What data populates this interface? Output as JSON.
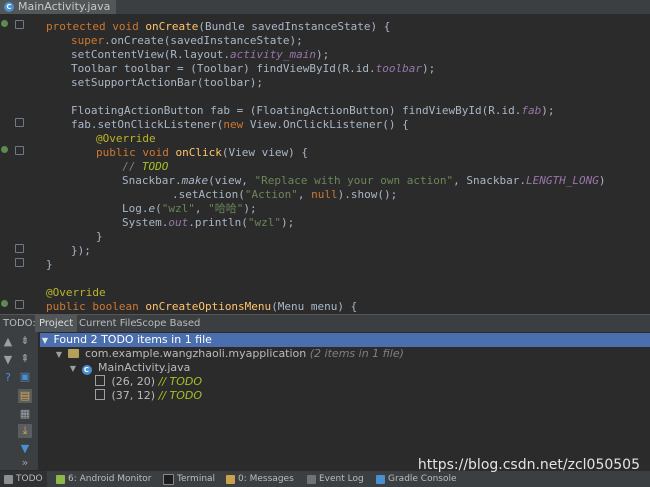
{
  "editor_tab": {
    "label": "MainActivity.java",
    "icon": "java-class-icon"
  },
  "code": {
    "line1": {
      "t1": "protected void ",
      "fn": "onCreate",
      "t2": "(Bundle savedInstanceState) {"
    },
    "line2": {
      "kw": "super",
      "t": ".onCreate(savedInstanceState);"
    },
    "line3": {
      "t1": "setContentView(R.layout.",
      "it": "activity_main",
      "t2": ");"
    },
    "line4": {
      "t1": "Toolbar toolbar = (Toolbar) findViewById(R.id.",
      "it": "toolbar",
      "t2": ");"
    },
    "line5": {
      "t": "setSupportActionBar(toolbar);"
    },
    "line6": {
      "t1": "FloatingActionButton fab = (FloatingActionButton) findViewById(R.id.",
      "it": "fab",
      "t2": ");"
    },
    "line7": {
      "t1": "fab.setOnClickListener(",
      "kw": "new",
      "t2": " View.OnClickListener() {"
    },
    "line8": {
      "an": "@Override"
    },
    "line9": {
      "kw": "public void ",
      "fn": "onClick",
      "t": "(View view) {"
    },
    "line10": {
      "cm": "// ",
      "td": "TODO"
    },
    "line11": {
      "t1": "Snackbar.",
      "m": "make",
      "t2": "(view, ",
      "st": "\"Replace with your own action\"",
      "t3": ", Snackbar.",
      "it": "LENGTH_LONG",
      "t4": ")"
    },
    "line12": {
      "t1": ".setAction(",
      "st": "\"Action\"",
      "t2": ", ",
      "kw": "null",
      "t3": ").show();"
    },
    "line13": {
      "t1": "Log.",
      "m": "e",
      "t2": "(",
      "s1": "\"wzl\"",
      "t3": ", ",
      "s2": "\"哈哈\"",
      "t4": ");"
    },
    "line14": {
      "t1": "System.",
      "it": "out",
      "t2": ".println(",
      "st": "\"wzl\"",
      "t3": ");"
    },
    "line15": {
      "t": "}"
    },
    "line16": {
      "t": "});"
    },
    "line17": {
      "t": "}"
    },
    "line18": {
      "an": "@Override"
    },
    "line19": {
      "kw": "public boolean ",
      "fn": "onCreateOptionsMenu",
      "t": "(Menu menu) {"
    }
  },
  "todo_window": {
    "title": "TODO:",
    "tabs": [
      "Project",
      "Current File",
      "Scope Based"
    ],
    "active_tab": "Project",
    "summary": "Found 2 TODO items in 1 file",
    "package": "com.example.wangzhaoli.myapplication",
    "package_count": "(2 items in 1 file)",
    "file": "MainActivity.java",
    "items": [
      {
        "pos": "(26, 20)",
        "text": "// TODO"
      },
      {
        "pos": "(37, 12)",
        "text": "// TODO"
      }
    ]
  },
  "statusbar": {
    "todo": "TODO",
    "android_monitor": "6: Android Monitor",
    "terminal": "Terminal",
    "messages": "0: Messages",
    "event_log": "Event Log",
    "gradle_console": "Gradle Console"
  },
  "watermark": "https://blog.csdn.net/zcl050505",
  "colors": {
    "editor_bg": "#2b2b2b",
    "keyword": "#cc7832",
    "method_decl": "#ffc66d",
    "string": "#6a8759",
    "field_italic": "#9876aa",
    "annotation": "#bbb529",
    "todo": "#a8c023",
    "selection": "#4b6eaf"
  }
}
